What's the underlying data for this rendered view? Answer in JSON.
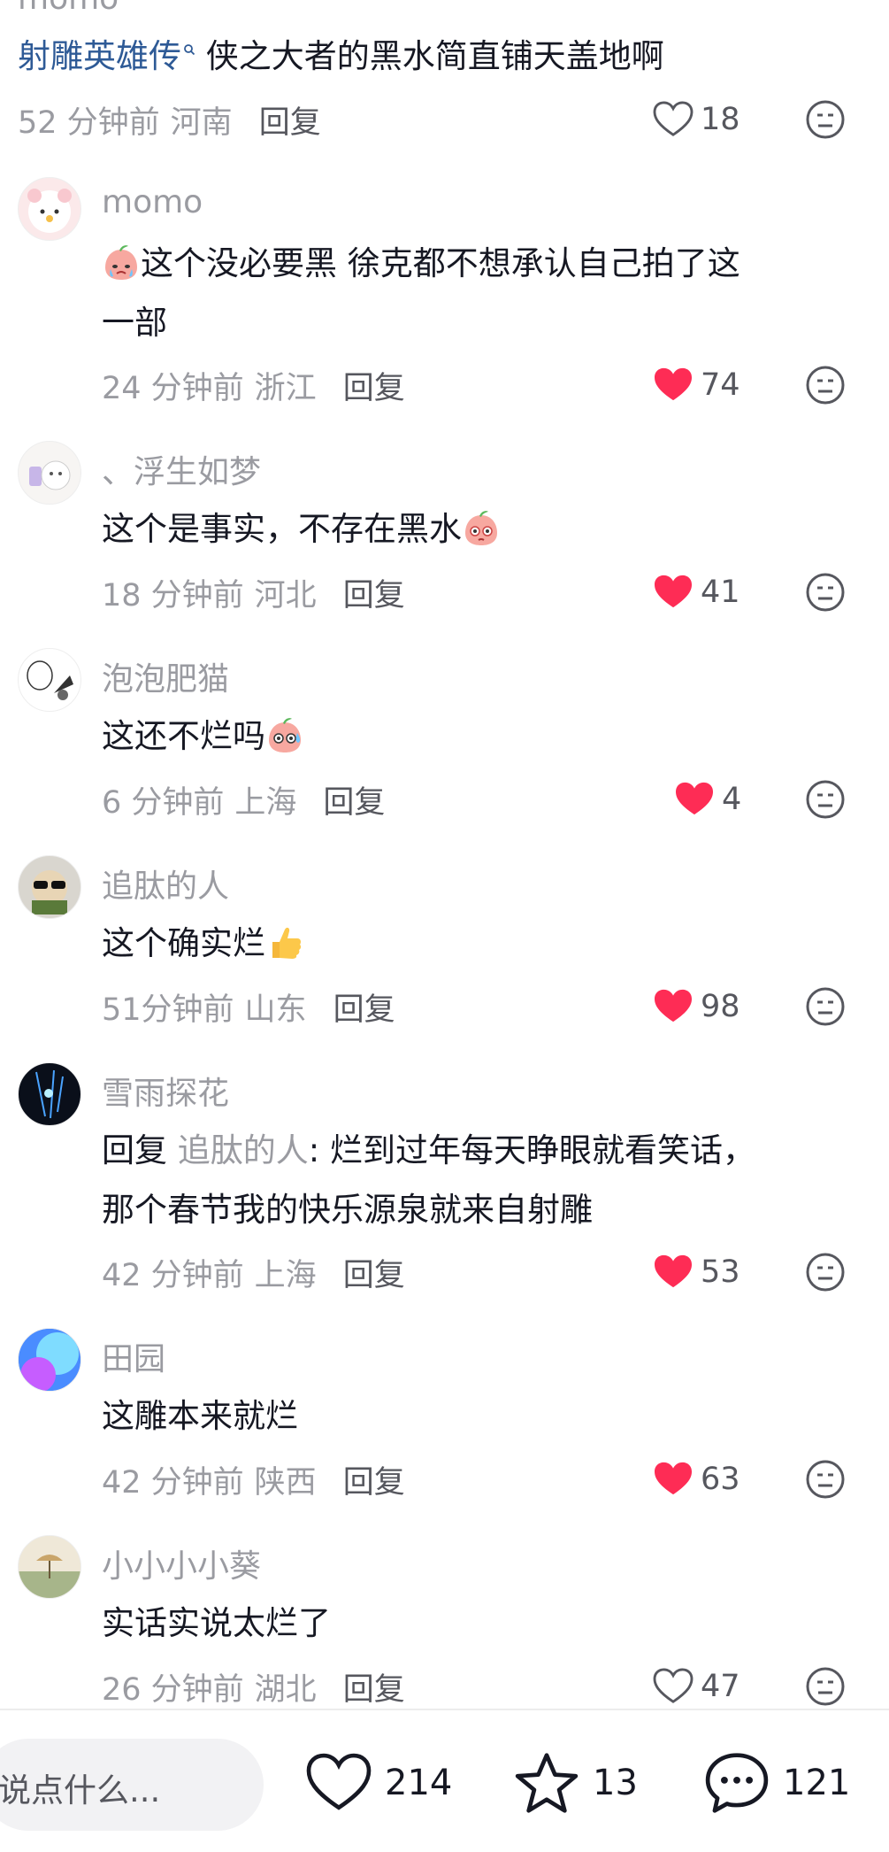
{
  "top_partial_name": "momo",
  "first_comment": {
    "link_text": "射雕英雄传",
    "text": " 侠之大者的黑水简直铺天盖地啊",
    "time": "52 分钟前",
    "location": "河南",
    "reply": "回复",
    "likes": "18",
    "liked": false
  },
  "comments": [
    {
      "username": "momo",
      "text_lines": [
        "这个没必要黑  徐克都不想承认自己拍了这",
        "一部"
      ],
      "time": "24 分钟前",
      "location": "浙江",
      "reply": "回复",
      "likes": "74",
      "liked": true,
      "avatar": "pink-bunny-avatar",
      "emoji": "crying-peach-emoji"
    },
    {
      "username": "、浮生如梦",
      "text": "这个是事实，不存在黑水",
      "time": "18 分钟前",
      "location": "河北",
      "reply": "回复",
      "likes": "41",
      "liked": true,
      "avatar": "cat-avatar",
      "emoji": "shy-peach-emoji"
    },
    {
      "username": "泡泡肥猫",
      "text": "这还不烂吗",
      "time": "6 分钟前",
      "location": "上海",
      "reply": "回复",
      "likes": "4",
      "liked": true,
      "avatar": "comic-avatar",
      "emoji": "sweat-peach-emoji"
    },
    {
      "username": "追肽的人",
      "text": "这个确实烂",
      "time": "51分钟前",
      "location": "山东",
      "reply": "回复",
      "likes": "98",
      "liked": true,
      "avatar": "sunglasses-avatar",
      "emoji": "thumbs-up-emoji"
    },
    {
      "username": "雪雨探花",
      "reply_prefix": "回复 ",
      "reply_to": "追肽的人",
      "reply_colon": ": 烂到过年每天睁眼就看笑话，",
      "text_line2": "那个春节我的快乐源泉就来自射雕",
      "time": "42 分钟前",
      "location": "上海",
      "reply": "回复",
      "likes": "53",
      "liked": true,
      "avatar": "dark-art-avatar"
    },
    {
      "username": "田园",
      "text": "这雕本来就烂",
      "time": "42 分钟前",
      "location": "陕西",
      "reply": "回复",
      "likes": "63",
      "liked": true,
      "avatar": "blue-gradient-avatar"
    },
    {
      "username": "小小小小葵",
      "text": "实话实说太烂了",
      "time": "26 分钟前",
      "location": "湖北",
      "reply": "回复",
      "likes": "47",
      "liked": false,
      "avatar": "landscape-avatar"
    }
  ],
  "bottom_bar": {
    "input_placeholder": "说点什么...",
    "likes": "214",
    "favorites": "13",
    "comments": "121"
  },
  "colors": {
    "like_red": "#fe2c55",
    "link_blue": "#2e5a96",
    "meta_gray": "#9a9ba1"
  }
}
